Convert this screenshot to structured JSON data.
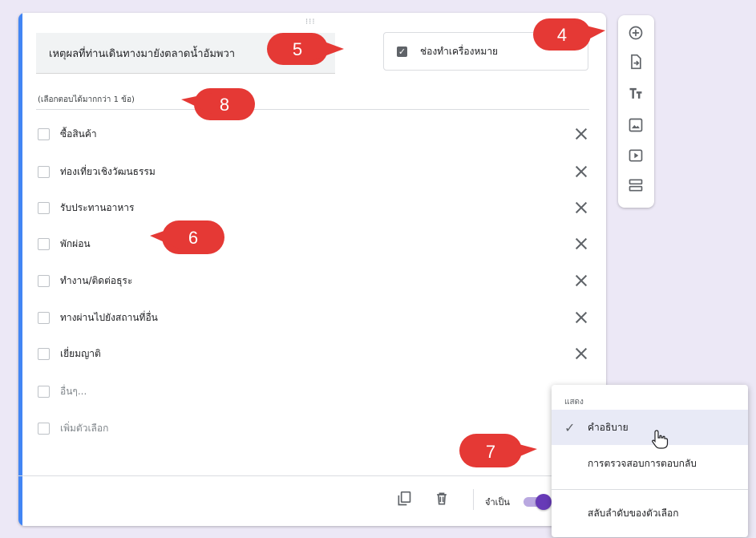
{
  "question": {
    "title": "เหตุผลที่ท่านเดินทางมายังตลาดน้ำอัมพวา",
    "type_label": "ช่องทำเครื่องหมาย",
    "help_text": "(เลือกตอบได้มากกว่า 1 ข้อ)",
    "options": [
      {
        "label": "ซื้อสินค้า"
      },
      {
        "label": "ท่องเที่ยวเชิงวัฒนธรรม"
      },
      {
        "label": "รับประทานอาหาร"
      },
      {
        "label": "พักผ่อน"
      },
      {
        "label": "ทำงาน/ติดต่อธุระ"
      },
      {
        "label": "ทางผ่านไปยังสถานที่อื่น"
      },
      {
        "label": "เยี่ยมญาติ"
      }
    ],
    "other_label": "อื่นๆ...",
    "add_option_label": "เพิ่มตัวเลือก"
  },
  "footer": {
    "required_label": "จำเป็น",
    "required_on": true
  },
  "toolbar": {
    "icons": [
      "add-circle-icon",
      "import-question-icon",
      "title-text-icon",
      "image-icon",
      "video-icon",
      "section-icon"
    ]
  },
  "menu": {
    "header": "แสดง",
    "items": [
      {
        "label": "คำอธิบาย",
        "checked": true
      },
      {
        "label": "การตรวจสอบการตอบกลับ",
        "checked": false
      },
      {
        "label": "สลับลำดับของตัวเลือก",
        "checked": false
      }
    ]
  },
  "badges": {
    "b4": "4",
    "b5": "5",
    "b6": "6",
    "b7": "7",
    "b8": "8"
  },
  "colors": {
    "accent": "#4285f4",
    "toggle": "#673ab7",
    "badge": "#e53935",
    "background": "#ece8f6"
  }
}
